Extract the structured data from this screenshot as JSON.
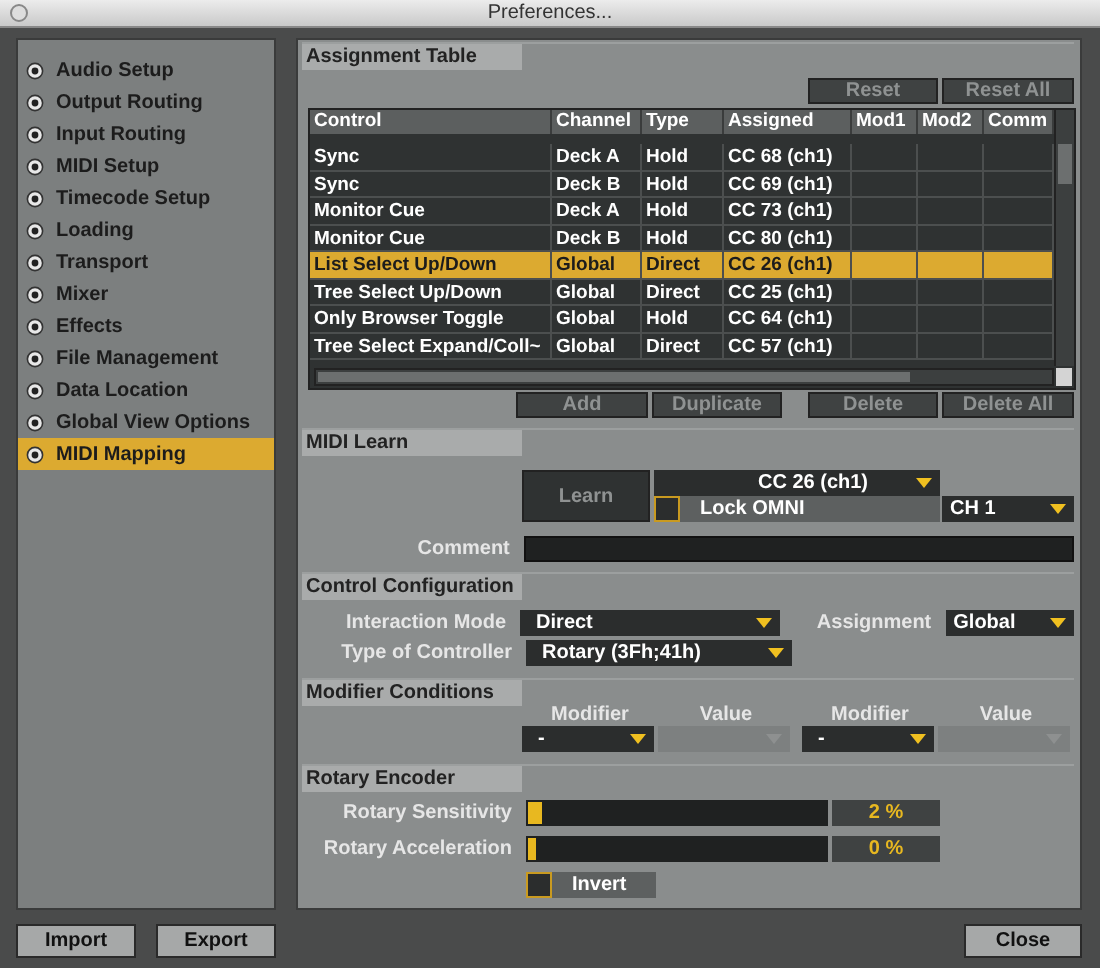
{
  "window": {
    "title": "Preferences..."
  },
  "sidebar": {
    "items": [
      {
        "label": "Audio Setup",
        "selected": false
      },
      {
        "label": "Output Routing",
        "selected": false
      },
      {
        "label": "Input Routing",
        "selected": false
      },
      {
        "label": "MIDI Setup",
        "selected": false
      },
      {
        "label": "Timecode Setup",
        "selected": false
      },
      {
        "label": "Loading",
        "selected": false
      },
      {
        "label": "Transport",
        "selected": false
      },
      {
        "label": "Mixer",
        "selected": false
      },
      {
        "label": "Effects",
        "selected": false
      },
      {
        "label": "File Management",
        "selected": false
      },
      {
        "label": "Data Location",
        "selected": false
      },
      {
        "label": "Global View Options",
        "selected": false
      },
      {
        "label": "MIDI Mapping",
        "selected": true
      }
    ]
  },
  "assignment_table": {
    "title": "Assignment Table",
    "buttons": [
      {
        "label": "Reset",
        "disabled": true
      },
      {
        "label": "Reset All",
        "disabled": true
      }
    ],
    "columns": [
      "Control",
      "Channel",
      "Type",
      "Assigned",
      "Mod1",
      "Mod2",
      "Comm"
    ],
    "rows": [
      {
        "cells": [
          "Sync",
          "Deck A",
          "Hold",
          "CC 68 (ch1)"
        ],
        "selected": false
      },
      {
        "cells": [
          "Sync",
          "Deck B",
          "Hold",
          "CC 69 (ch1)"
        ],
        "selected": false
      },
      {
        "cells": [
          "Monitor Cue",
          "Deck A",
          "Hold",
          "CC 73 (ch1)"
        ],
        "selected": false
      },
      {
        "cells": [
          "Monitor Cue",
          "Deck B",
          "Hold",
          "CC 80 (ch1)"
        ],
        "selected": false
      },
      {
        "cells": [
          "List Select Up/Down",
          "Global",
          "Direct",
          "CC 26 (ch1)"
        ],
        "selected": true
      },
      {
        "cells": [
          "Tree Select Up/Down",
          "Global",
          "Direct",
          "CC 25 (ch1)"
        ],
        "selected": false
      },
      {
        "cells": [
          "Only Browser Toggle",
          "Global",
          "Hold",
          "CC 64 (ch1)"
        ],
        "selected": false
      },
      {
        "cells": [
          "Tree Select Expand/Coll~",
          "Global",
          "Direct",
          "CC 57 (ch1)"
        ],
        "selected": false
      }
    ],
    "actions": [
      {
        "label": "Add",
        "disabled": true
      },
      {
        "label": "Duplicate",
        "disabled": true
      },
      {
        "label": "Delete",
        "disabled": true
      },
      {
        "label": "Delete All",
        "disabled": true
      }
    ]
  },
  "midi_learn": {
    "title": "MIDI Learn",
    "learn": {
      "label": "Learn",
      "disabled": true
    },
    "assigned": "CC 26 (ch1)",
    "lock_omni": {
      "label": "Lock OMNI",
      "checked": false
    },
    "channel": "CH 1",
    "comment_label": "Comment"
  },
  "control_configuration": {
    "title": "Control Configuration",
    "interaction_mode": {
      "label": "Interaction Mode",
      "value": "Direct"
    },
    "assignment": {
      "label": "Assignment",
      "value": "Global"
    },
    "type_of_controller": {
      "label": "Type of Controller",
      "value": "Rotary (3Fh;41h)"
    }
  },
  "modifier_conditions": {
    "title": "Modifier Conditions",
    "conditions": [
      {
        "modifier_label": "Modifier",
        "value_label": "Value",
        "modifier": "-",
        "value_disabled": true
      },
      {
        "modifier_label": "Modifier",
        "value_label": "Value",
        "modifier": "-",
        "value_disabled": true
      }
    ]
  },
  "rotary_encoder": {
    "title": "Rotary Encoder",
    "sliders": [
      {
        "label": "Rotary Sensitivity",
        "level": 0.02,
        "reading": "2 %"
      },
      {
        "label": "Rotary Acceleration",
        "level": 0,
        "reading": "0 %"
      }
    ],
    "invert": {
      "label": "Invert",
      "checked": false
    }
  },
  "footer": {
    "buttons": [
      "Import",
      "Export"
    ],
    "close": "Close"
  }
}
